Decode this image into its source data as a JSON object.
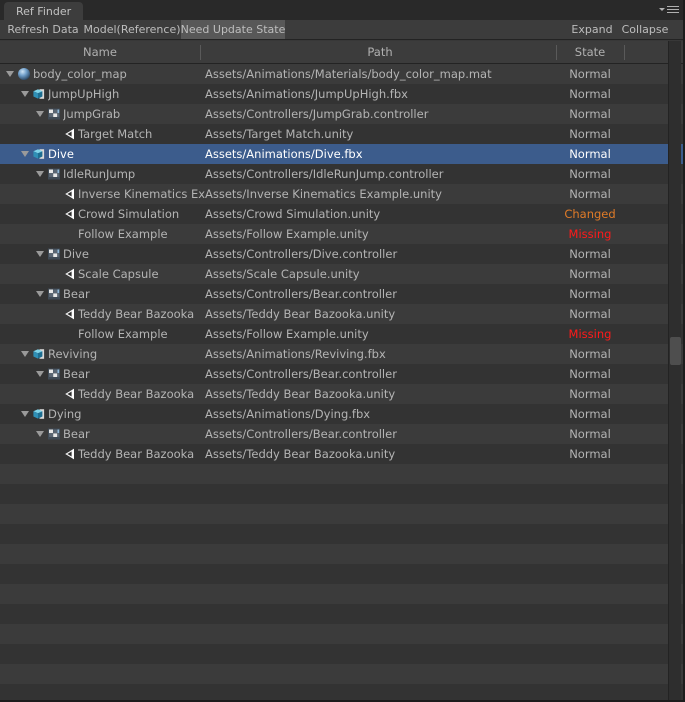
{
  "window": {
    "tab_label": "Ref Finder",
    "menu_icon": "hamburger-menu-icon"
  },
  "toolbar": {
    "refresh_label": "Refresh Data",
    "model_label": "Model(Reference)",
    "need_update_label": "Need Update State",
    "expand_label": "Expand",
    "collapse_label": "Collapse"
  },
  "columns": {
    "name": "Name",
    "path": "Path",
    "state": "State"
  },
  "colors": {
    "selection": "#3c5c8c",
    "state_normal": "#b4b4b4",
    "state_changed": "#e07b28",
    "state_missing": "#ff1a1a",
    "row_odd": "#3b3b3b",
    "row_even": "#333333"
  },
  "rows": [
    {
      "depth": 0,
      "expanded": true,
      "icon": "material-sphere-icon",
      "name": "body_color_map",
      "path": "Assets/Animations/Materials/body_color_map.mat",
      "state": "Normal",
      "selected": false
    },
    {
      "depth": 1,
      "expanded": true,
      "icon": "fbx-model-icon",
      "name": "JumpUpHigh",
      "path": "Assets/Animations/JumpUpHigh.fbx",
      "state": "Normal",
      "selected": false
    },
    {
      "depth": 2,
      "expanded": true,
      "icon": "animator-controller-icon",
      "name": "JumpGrab",
      "path": "Assets/Controllers/JumpGrab.controller",
      "state": "Normal",
      "selected": false
    },
    {
      "depth": 3,
      "expanded": false,
      "icon": "unity-scene-icon",
      "name": "Target Match",
      "path": "Assets/Target Match.unity",
      "state": "Normal",
      "selected": false
    },
    {
      "depth": 1,
      "expanded": true,
      "icon": "fbx-model-icon",
      "name": "Dive",
      "path": "Assets/Animations/Dive.fbx",
      "state": "Normal",
      "selected": true
    },
    {
      "depth": 2,
      "expanded": true,
      "icon": "animator-controller-icon",
      "name": "IdleRunJump",
      "path": "Assets/Controllers/IdleRunJump.controller",
      "state": "Normal",
      "selected": false
    },
    {
      "depth": 3,
      "expanded": false,
      "icon": "unity-scene-icon",
      "name": "Inverse Kinematics Ex",
      "path": "Assets/Inverse Kinematics Example.unity",
      "state": "Normal",
      "selected": false
    },
    {
      "depth": 3,
      "expanded": false,
      "icon": "unity-scene-icon",
      "name": "Crowd Simulation",
      "path": "Assets/Crowd Simulation.unity",
      "state": "Changed",
      "selected": false
    },
    {
      "depth": 3,
      "expanded": false,
      "icon": "none",
      "name": "Follow Example",
      "path": "Assets/Follow Example.unity",
      "state": "Missing",
      "selected": false
    },
    {
      "depth": 2,
      "expanded": true,
      "icon": "animator-controller-icon",
      "name": "Dive",
      "path": "Assets/Controllers/Dive.controller",
      "state": "Normal",
      "selected": false
    },
    {
      "depth": 3,
      "expanded": false,
      "icon": "unity-scene-icon",
      "name": "Scale Capsule",
      "path": "Assets/Scale Capsule.unity",
      "state": "Normal",
      "selected": false
    },
    {
      "depth": 2,
      "expanded": true,
      "icon": "animator-controller-icon",
      "name": "Bear",
      "path": "Assets/Controllers/Bear.controller",
      "state": "Normal",
      "selected": false
    },
    {
      "depth": 3,
      "expanded": false,
      "icon": "unity-scene-icon",
      "name": "Teddy Bear Bazooka",
      "path": "Assets/Teddy Bear Bazooka.unity",
      "state": "Normal",
      "selected": false
    },
    {
      "depth": 3,
      "expanded": false,
      "icon": "none",
      "name": "Follow Example",
      "path": "Assets/Follow Example.unity",
      "state": "Missing",
      "selected": false
    },
    {
      "depth": 1,
      "expanded": true,
      "icon": "fbx-model-icon",
      "name": "Reviving",
      "path": "Assets/Animations/Reviving.fbx",
      "state": "Normal",
      "selected": false
    },
    {
      "depth": 2,
      "expanded": true,
      "icon": "animator-controller-icon",
      "name": "Bear",
      "path": "Assets/Controllers/Bear.controller",
      "state": "Normal",
      "selected": false
    },
    {
      "depth": 3,
      "expanded": false,
      "icon": "unity-scene-icon",
      "name": "Teddy Bear Bazooka",
      "path": "Assets/Teddy Bear Bazooka.unity",
      "state": "Normal",
      "selected": false
    },
    {
      "depth": 1,
      "expanded": true,
      "icon": "fbx-model-icon",
      "name": "Dying",
      "path": "Assets/Animations/Dying.fbx",
      "state": "Normal",
      "selected": false
    },
    {
      "depth": 2,
      "expanded": true,
      "icon": "animator-controller-icon",
      "name": "Bear",
      "path": "Assets/Controllers/Bear.controller",
      "state": "Normal",
      "selected": false
    },
    {
      "depth": 3,
      "expanded": false,
      "icon": "unity-scene-icon",
      "name": "Teddy Bear Bazooka",
      "path": "Assets/Teddy Bear Bazooka.unity",
      "state": "Normal",
      "selected": false
    }
  ],
  "empty_row_count": 12
}
